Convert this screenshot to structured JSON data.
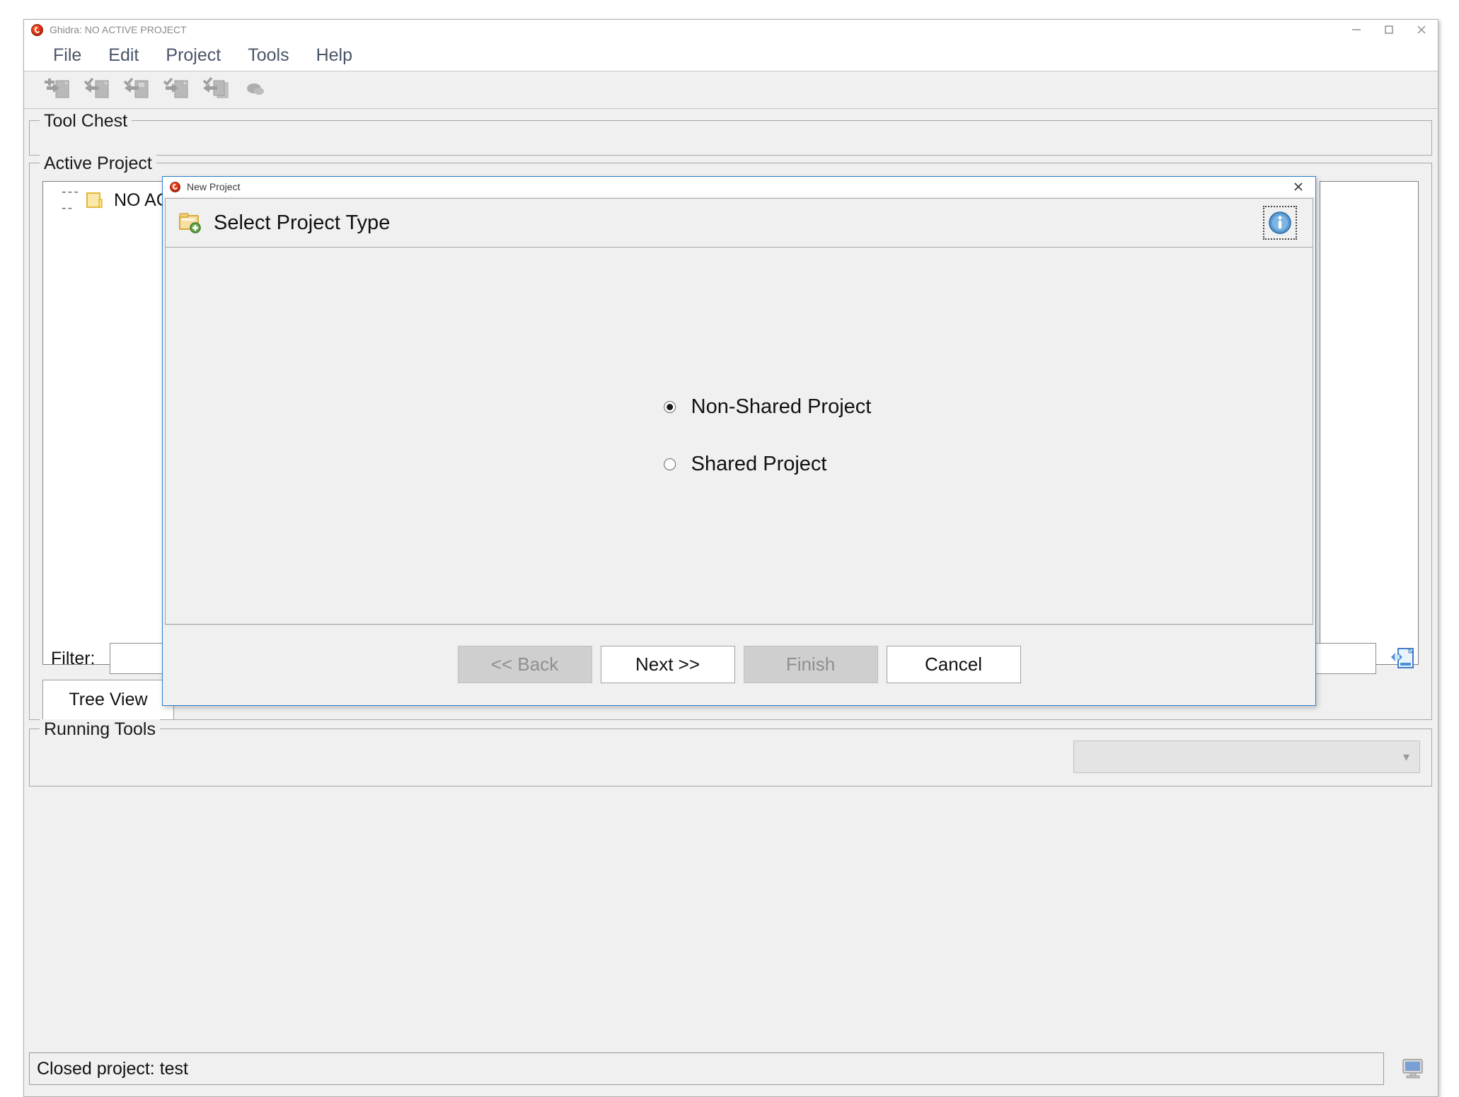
{
  "window": {
    "title": "Ghidra: NO ACTIVE PROJECT",
    "logo_icon": "ghidra-dragon-icon",
    "controls": {
      "minimize": "minimize-icon",
      "maximize": "maximize-icon",
      "close": "close-icon"
    }
  },
  "menu": {
    "items": [
      {
        "label": "File"
      },
      {
        "label": "Edit"
      },
      {
        "label": "Project"
      },
      {
        "label": "Tools"
      },
      {
        "label": "Help"
      }
    ]
  },
  "toolbar": {
    "buttons": [
      {
        "name": "new-project-icon",
        "tip": "New Project"
      },
      {
        "name": "open-project-icon",
        "tip": "Open Project"
      },
      {
        "name": "save-project-icon",
        "tip": "Save Project"
      },
      {
        "name": "import-file-icon",
        "tip": "Import File"
      },
      {
        "name": "batch-import-icon",
        "tip": "Batch Import"
      },
      {
        "name": "open-file-system-icon",
        "tip": "Open File System"
      }
    ]
  },
  "panels": {
    "tool_chest": {
      "title": "Tool Chest"
    },
    "active_project": {
      "title": "Active Project"
    },
    "running_tools": {
      "title": "Running Tools"
    }
  },
  "tree": {
    "connector": "-----",
    "folder_icon": "folder-icon",
    "root_label": "NO ACTIVE PROJECT"
  },
  "filter": {
    "label": "Filter:",
    "value": "",
    "placeholder": "",
    "icon": "filter-document-icon"
  },
  "tabs": {
    "tree_view": {
      "label": "Tree View",
      "selected": true
    }
  },
  "status": {
    "message": "Closed project: test",
    "icon": "monitor-icon"
  },
  "dialog": {
    "window_title": "New Project",
    "logo_icon": "ghidra-dragon-icon",
    "close_icon": "close-icon",
    "header": {
      "icon": "new-folder-icon",
      "title": "Select Project Type",
      "info_icon": "info-icon"
    },
    "options": [
      {
        "label": "Non-Shared Project",
        "selected": true
      },
      {
        "label": "Shared Project",
        "selected": false
      }
    ],
    "buttons": [
      {
        "label": "<< Back",
        "enabled": false
      },
      {
        "label": "Next >>",
        "enabled": true
      },
      {
        "label": "Finish",
        "enabled": false
      },
      {
        "label": "Cancel",
        "enabled": true
      }
    ]
  },
  "colors": {
    "accent_blue": "#2a7fd4",
    "panel_bg": "#f0f0f0",
    "menu_text": "#4a5568",
    "title_text": "#8a8a8a",
    "folder_yellow": "#f5d878",
    "disabled_gray": "#cfcfcf"
  }
}
